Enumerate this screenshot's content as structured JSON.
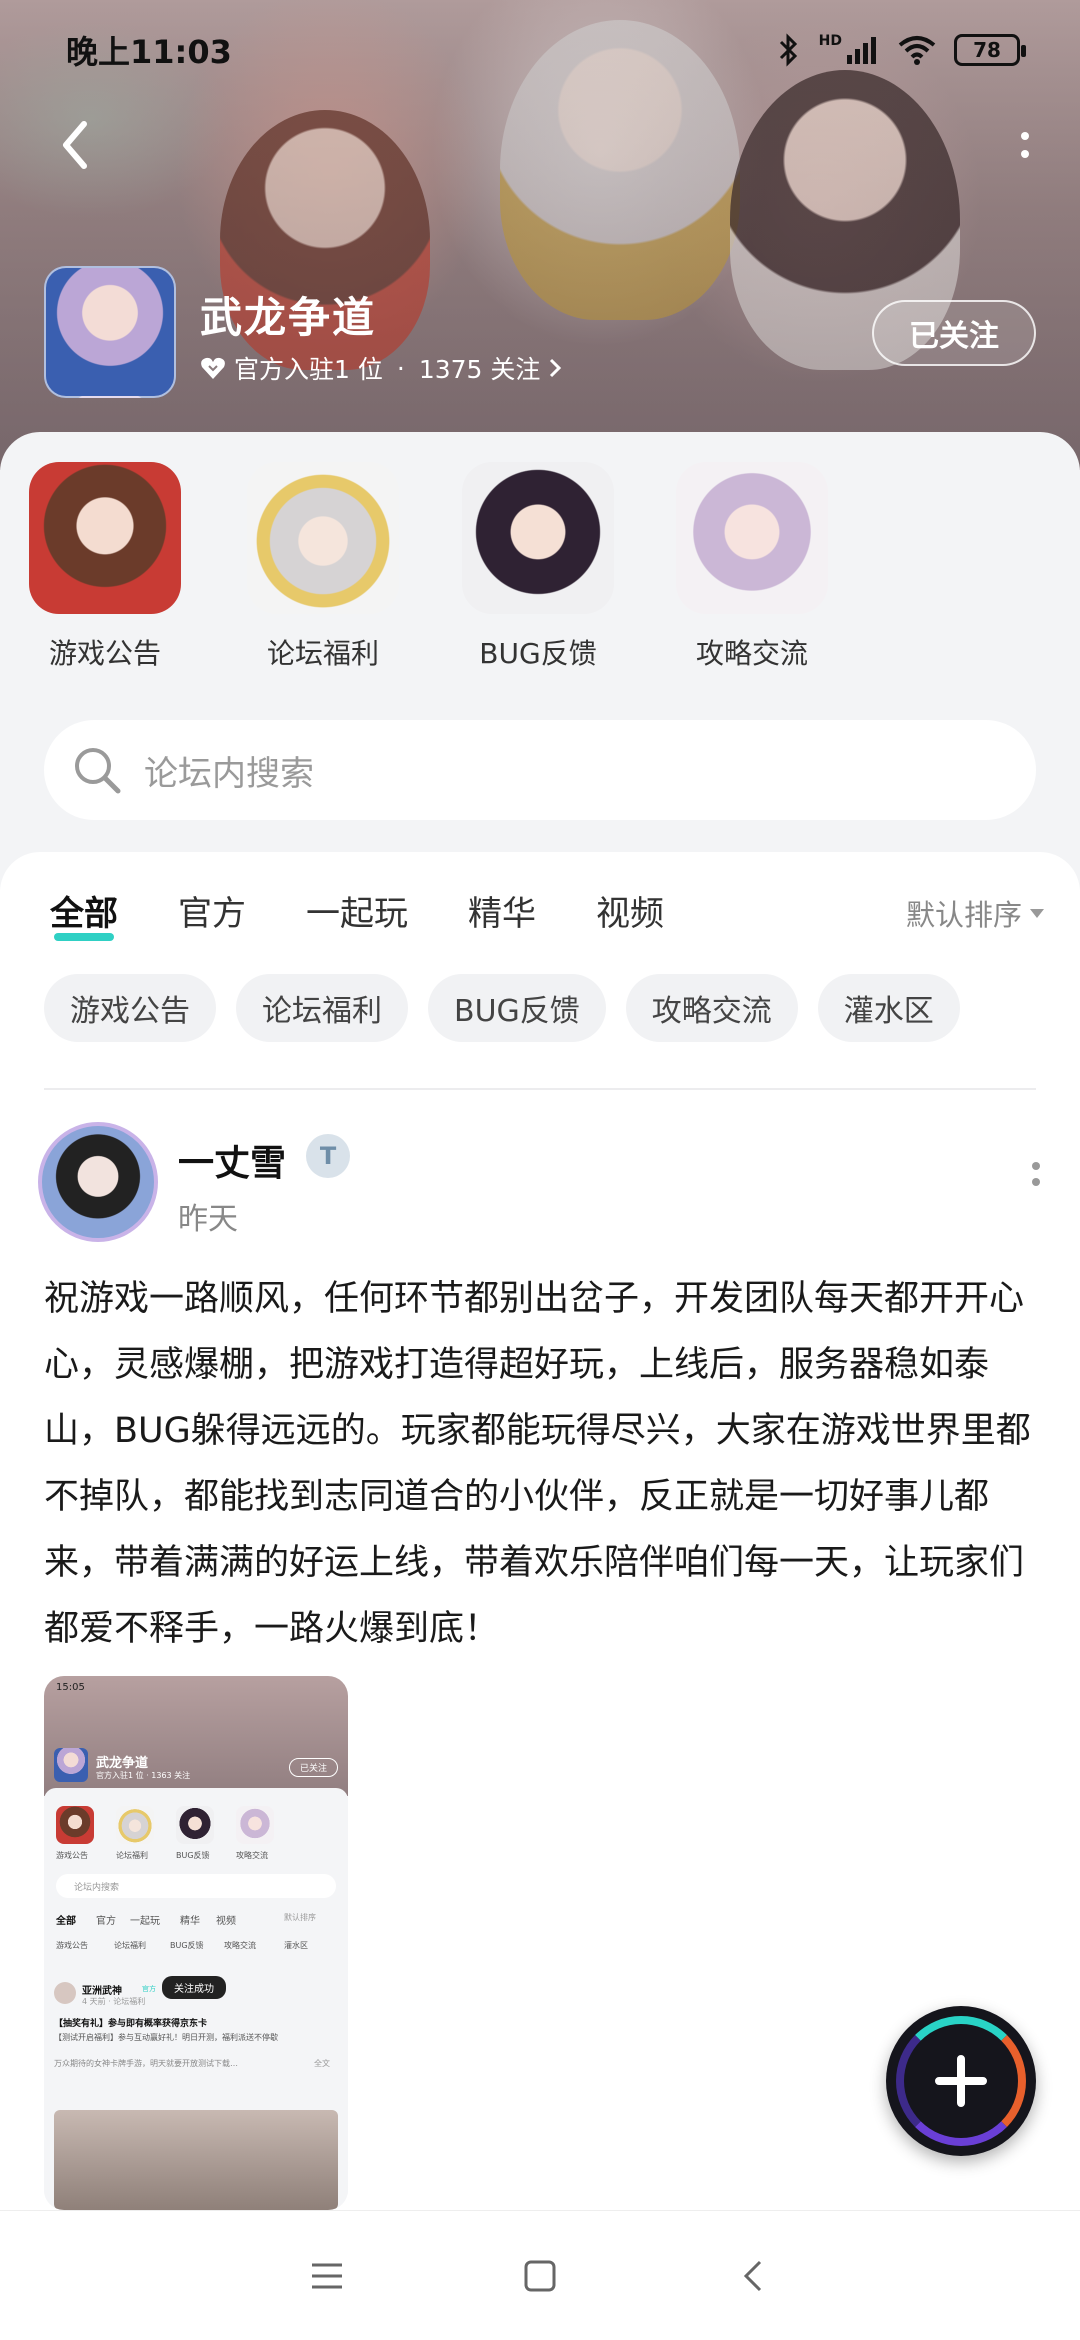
{
  "status_bar": {
    "time": "晚上11:03",
    "network_label": "HD",
    "battery": "78"
  },
  "header": {
    "forum_title": "武龙争道",
    "official_count": "官方入驻1 位",
    "separator": "·",
    "followers": "1375 关注",
    "follow_button": "已关注"
  },
  "sections": [
    {
      "label": "游戏公告"
    },
    {
      "label": "论坛福利"
    },
    {
      "label": "BUG反馈"
    },
    {
      "label": "攻略交流"
    }
  ],
  "search": {
    "placeholder": "论坛内搜索"
  },
  "tabs": [
    {
      "label": "全部",
      "active": true
    },
    {
      "label": "官方",
      "active": false
    },
    {
      "label": "一起玩",
      "active": false
    },
    {
      "label": "精华",
      "active": false
    },
    {
      "label": "视频",
      "active": false
    }
  ],
  "sort_label": "默认排序",
  "chips": [
    "游戏公告",
    "论坛福利",
    "BUG反馈",
    "攻略交流",
    "灌水区"
  ],
  "post": {
    "author": "一丈雪",
    "time": "昨天",
    "body": "祝游戏一路顺风，任何环节都别出岔子，开发团队每天都开开心心，灵感爆棚，把游戏打造得超好玩，上线后，服务器稳如泰山，BUG躲得远远的。玩家都能玩得尽兴，大家在游戏世界里都不掉队，都能找到志同道合的小伙伴，反正就是一切好事儿都来，带着满满的好运上线，带着欢乐陪伴咱们每一天，让玩家们都爱不释手，一路火爆到底！"
  },
  "post_image": {
    "time": "15:05",
    "title": "武龙争道",
    "meta": "官方入驻1 位 · 1363 关注",
    "follow": "已关注",
    "sections": [
      "游戏公告",
      "论坛福利",
      "BUG反馈",
      "攻略交流"
    ],
    "search": "论坛内搜索",
    "tabs": [
      "全部",
      "官方",
      "一起玩",
      "精华",
      "视频"
    ],
    "sort": "默认排序",
    "chips": [
      "游戏公告",
      "论坛福利",
      "BUG反馈",
      "攻略交流",
      "灌水区"
    ],
    "author": "亚洲武神",
    "author_tag": "官方",
    "author_time": "4 天前 · 论坛福利",
    "toast": "关注成功",
    "post_title": "【抽奖有礼】参与即有概率获得京东卡",
    "post_line1": "【测试开启福利】参与互动赢好礼！明日开测，福利派送不停歇",
    "post_line2": "万众期待的女神卡牌手游，明天就要开放测试下载…",
    "more": "全文"
  },
  "colors": {
    "accent_teal": "#2fd0c4",
    "fab_bg": "#15151c"
  },
  "icons": {
    "back": "chevron-left-icon",
    "more": "more-vertical-icon",
    "search": "search-icon",
    "add": "plus-icon",
    "nav_menu": "menu-icon",
    "nav_home": "square-icon",
    "nav_back": "back-icon"
  }
}
